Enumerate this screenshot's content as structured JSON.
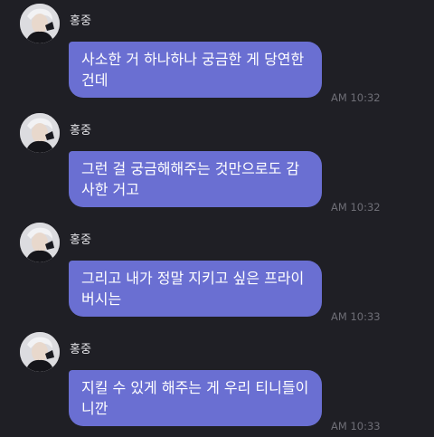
{
  "colors": {
    "background": "#1f1f25",
    "bubble": "#6a6fd2",
    "bubble_text": "#ffffff",
    "sender_text": "#e6e6ea",
    "time_text": "#6e6e76"
  },
  "messages": [
    {
      "sender": "홍중",
      "avatar_icon": "profile-photo-icon",
      "text": "사소한 거 하나하나 궁금한 게 당연한 건데",
      "time": "AM 10:32"
    },
    {
      "sender": "홍중",
      "avatar_icon": "profile-photo-icon",
      "text": "그런 걸 궁금해해주는 것만으로도 감사한 거고",
      "time": "AM 10:32"
    },
    {
      "sender": "홍중",
      "avatar_icon": "profile-photo-icon",
      "text": "그리고 내가 정말 지키고 싶은 프라이버시는",
      "time": "AM 10:33"
    },
    {
      "sender": "홍중",
      "avatar_icon": "profile-photo-icon",
      "text": "지킬 수 있게 해주는 게 우리 티니들이니깐",
      "time": "AM 10:33"
    }
  ]
}
